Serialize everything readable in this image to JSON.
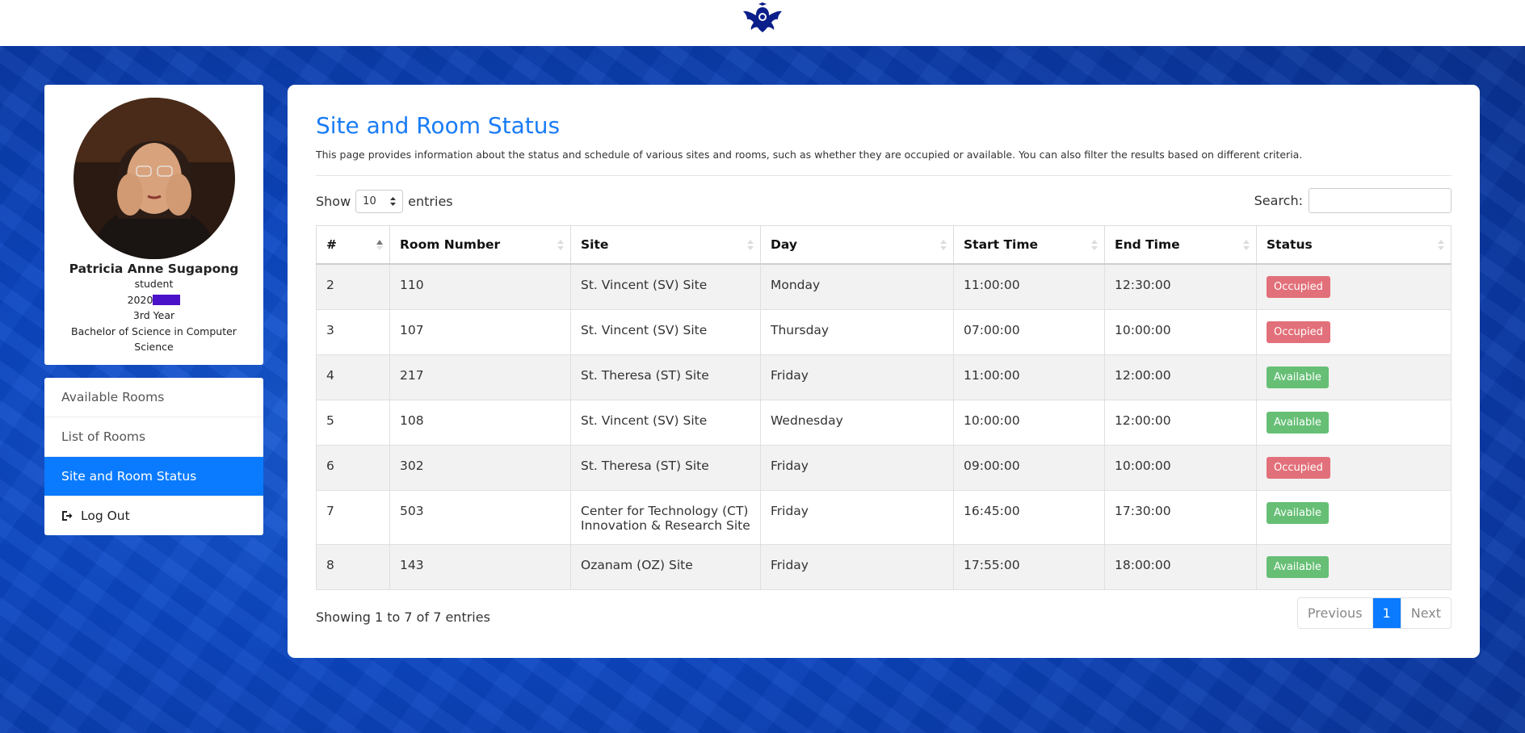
{
  "profile": {
    "name": "Patricia Anne Sugapong",
    "role": "student",
    "id_prefix": "2020",
    "year": "3rd Year",
    "program": "Bachelor of Science in Computer Science"
  },
  "menu": {
    "items": [
      {
        "label": "Available Rooms"
      },
      {
        "label": "List of Rooms"
      },
      {
        "label": "Site and Room Status"
      },
      {
        "label": "Log Out"
      }
    ]
  },
  "main": {
    "title": "Site and Room Status",
    "description": "This page provides information about the status and schedule of various sites and rooms, such as whether they are occupied or available. You can also filter the results based on different criteria.",
    "show_label": "Show",
    "entries_value": "10",
    "entries_label": "entries",
    "search_label": "Search:",
    "search_value": ""
  },
  "table": {
    "headers": [
      "#",
      "Room Number",
      "Site",
      "Day",
      "Start Time",
      "End Time",
      "Status"
    ],
    "rows": [
      {
        "num": "2",
        "room": "110",
        "site": "St. Vincent (SV) Site",
        "day": "Monday",
        "start": "11:00:00",
        "end": "12:30:00",
        "status": "Occupied"
      },
      {
        "num": "3",
        "room": "107",
        "site": "St. Vincent (SV) Site",
        "day": "Thursday",
        "start": "07:00:00",
        "end": "10:00:00",
        "status": "Occupied"
      },
      {
        "num": "4",
        "room": "217",
        "site": "St. Theresa (ST) Site",
        "day": "Friday",
        "start": "11:00:00",
        "end": "12:00:00",
        "status": "Available"
      },
      {
        "num": "5",
        "room": "108",
        "site": "St. Vincent (SV) Site",
        "day": "Wednesday",
        "start": "10:00:00",
        "end": "12:00:00",
        "status": "Available"
      },
      {
        "num": "6",
        "room": "302",
        "site": "St. Theresa (ST) Site",
        "day": "Friday",
        "start": "09:00:00",
        "end": "10:00:00",
        "status": "Occupied"
      },
      {
        "num": "7",
        "room": "503",
        "site": "Center for Technology (CT) Innovation & Research Site",
        "day": "Friday",
        "start": "16:45:00",
        "end": "17:30:00",
        "status": "Available"
      },
      {
        "num": "8",
        "room": "143",
        "site": "Ozanam (OZ) Site",
        "day": "Friday",
        "start": "17:55:00",
        "end": "18:00:00",
        "status": "Available"
      }
    ]
  },
  "footer": {
    "info": "Showing 1 to 7 of 7 entries",
    "previous": "Previous",
    "page": "1",
    "next": "Next"
  },
  "colors": {
    "accent": "#0a7bff",
    "occupied": "#e2707a",
    "available": "#66bf75",
    "background": "#0b47c4"
  }
}
